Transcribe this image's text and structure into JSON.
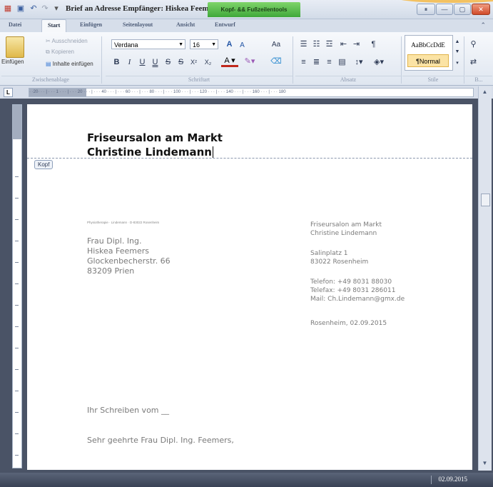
{
  "window": {
    "title": "Brief an Adresse Empfänger: Hiskea Feemers",
    "context_tab": "Kopf- && Fußzeilentools",
    "controls": [
      "⏸",
      "—",
      "▢",
      "✕"
    ]
  },
  "ribbon_tabs": [
    "Datei",
    "Start",
    "Einfügen",
    "Seitenlayout",
    "Ansicht",
    "Entwurf"
  ],
  "ribbon": {
    "clipboard": {
      "paste": "Einfügen",
      "cut": "Ausschneiden",
      "copy": "Kopieren",
      "paste_content": "Inhalte einfügen",
      "group": "Zwischenablage"
    },
    "font": {
      "family": "Verdana",
      "size": "16",
      "bold": "B",
      "italic": "I",
      "underline": "U",
      "double_underline": "U",
      "strikethrough": "S",
      "double_strike": "S",
      "superscript": "X²",
      "subscript": "X₂",
      "grow": "A",
      "shrink": "A",
      "case": "Aa",
      "group": "Schriftart"
    },
    "paragraph": {
      "group": "Absatz"
    },
    "styles": {
      "preview": "AaBbCcDdE",
      "normal": "¶Normal",
      "group": "Stile"
    },
    "editing": {
      "group": "B..."
    }
  },
  "ruler_text": "· ·20· · · | · · · 1 · · · | · · · 20 · · · | · · · 40 · · · | · · · 60 · · · | · · · 80 · · · | · · · 100 · · · | · · · 120 · · · | · · · 140 · · · | · · · 160 · · · | · · · 180",
  "document": {
    "header_line1": "Friseursalon am Markt",
    "header_line2": "Christine Lindemann",
    "header_badge": "Kopf",
    "sender_line": "Physiotherapie · Lindemann · D-83022 Rosenheim",
    "recipient": [
      "Frau Dipl. Ing.",
      "Hiskea Feemers",
      "Glockenbecherstr. 66",
      "83209 Prien"
    ],
    "sender_block": {
      "name": "Friseursalon am Markt",
      "owner": "Christine Lindemann",
      "street": "Salinplatz  1",
      "city": "83022 Rosenheim",
      "phone": "Telefon: +49 8031 88030",
      "fax": "Telefax: +49 8031 286011",
      "mail": "Mail: Ch.Lindemann@gmx.de",
      "date": "Rosenheim, 02.09.2015"
    },
    "reference": "Ihr Schreiben vom __",
    "salutation": "Sehr geehrte Frau Dipl. Ing. Feemers,"
  },
  "status": {
    "date": "02.09.2015"
  }
}
